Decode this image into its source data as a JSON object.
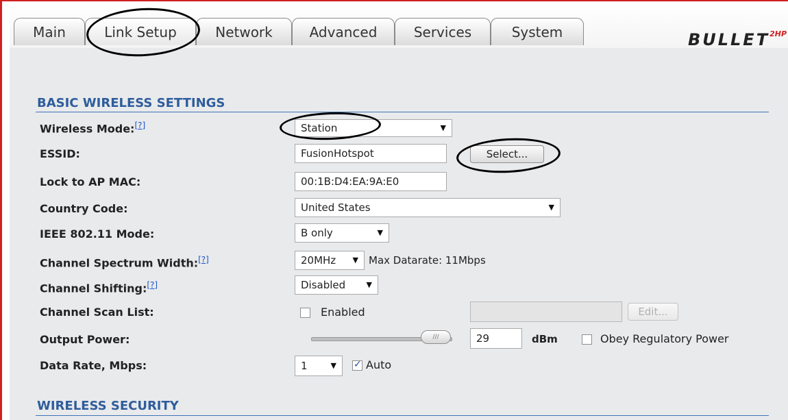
{
  "tabs": [
    "Main",
    "Link Setup",
    "Network",
    "Advanced",
    "Services",
    "System"
  ],
  "logo": {
    "text": "BULLET",
    "suffix": "2HP"
  },
  "basic": {
    "title": "BASIC WIRELESS SETTINGS",
    "wireless_mode": {
      "label": "Wireless Mode:",
      "value": "Station"
    },
    "essid": {
      "label": "ESSID:",
      "value": "FusionHotspot",
      "select_button": "Select..."
    },
    "lock_ap_mac": {
      "label": "Lock to AP MAC:",
      "value": "00:1B:D4:EA:9A:E0"
    },
    "country_code": {
      "label": "Country Code:",
      "value": "United States"
    },
    "ieee_mode": {
      "label": "IEEE 802.11 Mode:",
      "value": "B only"
    },
    "spectrum_width": {
      "label": "Channel Spectrum Width:",
      "value": "20MHz",
      "max_datarate": "Max Datarate: 11Mbps"
    },
    "channel_shifting": {
      "label": "Channel Shifting:",
      "value": "Disabled"
    },
    "scan_list": {
      "label": "Channel Scan List:",
      "checkbox_label": "Enabled",
      "checked": false,
      "edit_button": "Edit..."
    },
    "output_power": {
      "label": "Output Power:",
      "value": "29",
      "unit": "dBm",
      "obey_label": "Obey Regulatory Power",
      "obey_checked": false
    },
    "data_rate": {
      "label": "Data Rate, Mbps:",
      "value": "1",
      "auto_label": "Auto",
      "auto_checked": true
    }
  },
  "security": {
    "title": "WIRELESS SECURITY"
  },
  "help_marker": "[?]",
  "colors": {
    "section_title": "#2e5d9c",
    "panel_bg": "#e9eaec",
    "annotation": "#000000",
    "frame": "#d02020"
  }
}
